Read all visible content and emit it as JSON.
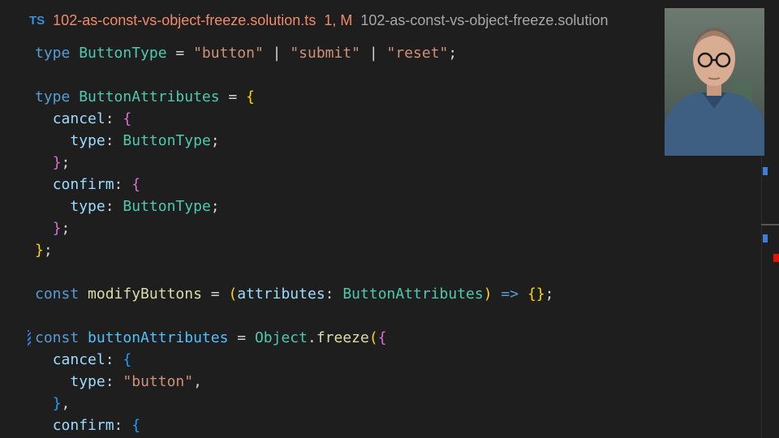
{
  "tab": {
    "language_badge": "TS",
    "filename": "102-as-const-vs-object-freeze.solution.ts",
    "status": "1, M",
    "breadcrumb": "102-as-const-vs-object-freeze.solution"
  },
  "code": {
    "l1": [
      "type",
      " ",
      "ButtonType",
      " = ",
      "\"button\"",
      " | ",
      "\"submit\"",
      " | ",
      "\"reset\"",
      ";"
    ],
    "l3": [
      "type",
      " ",
      "ButtonAttributes",
      " = ",
      "{"
    ],
    "l4": [
      "  ",
      "cancel",
      ": ",
      "{"
    ],
    "l5": [
      "    ",
      "type",
      ": ",
      "ButtonType",
      ";"
    ],
    "l6": [
      "  ",
      "}",
      ";"
    ],
    "l7": [
      "  ",
      "confirm",
      ": ",
      "{"
    ],
    "l8": [
      "    ",
      "type",
      ": ",
      "ButtonType",
      ";"
    ],
    "l9": [
      "  ",
      "}",
      ";"
    ],
    "l10": [
      "}",
      ";"
    ],
    "l12": [
      "const",
      " ",
      "modifyButtons",
      " = ",
      "(",
      "attributes",
      ": ",
      "ButtonAttributes",
      ")",
      " ",
      "=>",
      " ",
      "{}",
      ";"
    ],
    "l14": [
      "const",
      " ",
      "buttonAttributes",
      " = ",
      "Object",
      ".",
      "freeze",
      "(",
      "{"
    ],
    "l15": [
      "  ",
      "cancel",
      ": ",
      "{"
    ],
    "l16": [
      "    ",
      "type",
      ": ",
      "\"button\"",
      ","
    ],
    "l17": [
      "  ",
      "}",
      ","
    ],
    "l18": [
      "  ",
      "confirm",
      ": ",
      "{"
    ]
  },
  "colors": {
    "background": "#1e1e1e",
    "keyword": "#569cd6",
    "type": "#4ec9b0",
    "string": "#ce9178",
    "bracket_level1": "#ffd700",
    "bracket_level2": "#da70d6",
    "bracket_level3": "#179fff",
    "modified_tab": "#f08a6b",
    "scroll_marker_info": "#3b7fd6",
    "scroll_marker_error": "#e51400"
  },
  "webcam": {
    "description_icon": "presenter-webcam"
  }
}
